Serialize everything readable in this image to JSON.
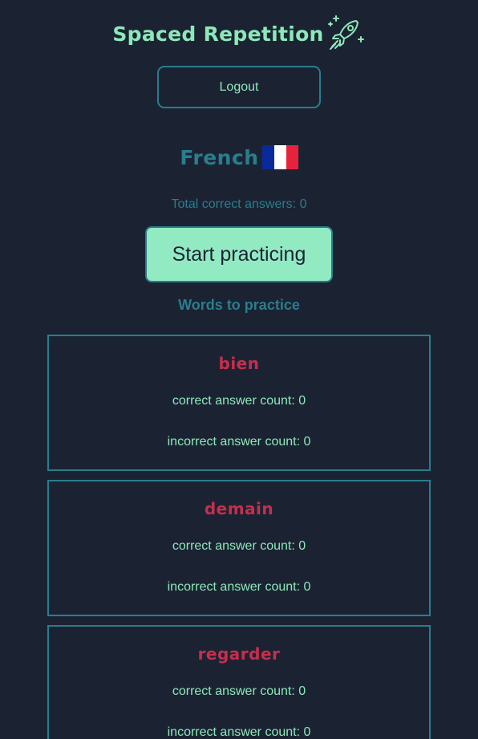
{
  "header": {
    "title": "Spaced Repetition",
    "logo_icon": "rocket-icon",
    "accent_color": "#8de8b8"
  },
  "logout_label": "Logout",
  "language": {
    "name": "French",
    "flag_icon": "france-flag-icon"
  },
  "total_correct_label": "Total correct answers: 0",
  "start_button_label": "Start practicing",
  "words_heading": "Words to practice",
  "words": [
    {
      "word": "bien",
      "correct_label": "correct answer count: 0",
      "incorrect_label": "incorrect answer count: 0"
    },
    {
      "word": "demain",
      "correct_label": "correct answer count: 0",
      "incorrect_label": "incorrect answer count: 0"
    },
    {
      "word": "regarder",
      "correct_label": "correct answer count: 0",
      "incorrect_label": "incorrect answer count: 0"
    }
  ],
  "colors": {
    "background": "#1b2333",
    "teal": "#2a7d8c",
    "mint": "#8de8b8",
    "word_red": "#c72e4d"
  }
}
